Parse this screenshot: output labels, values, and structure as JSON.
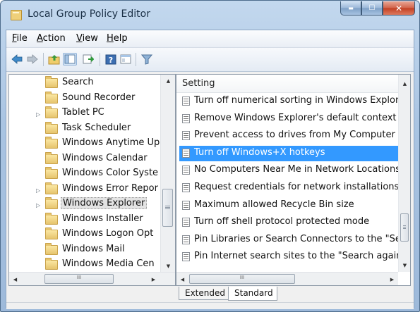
{
  "window": {
    "title": "Local Group Policy Editor",
    "controls": {
      "minimize": "▬",
      "maximize": "☐",
      "close": "✕"
    }
  },
  "menu": {
    "file": {
      "accel": "F",
      "rest": "ile"
    },
    "action": {
      "accel": "A",
      "rest": "ction"
    },
    "view": {
      "accel": "V",
      "rest": "iew"
    },
    "help": {
      "accel": "H",
      "rest": "elp"
    }
  },
  "toolbar": {
    "buttons": [
      "back-arrow-icon",
      "forward-arrow-icon",
      "up-folder-icon",
      "show-hide-tree-icon",
      "export-list-icon",
      "help-icon",
      "properties-icon",
      "filter-icon"
    ],
    "selected": "show-hide-tree-icon"
  },
  "tree": {
    "items": [
      {
        "label": "Search",
        "expandable": false
      },
      {
        "label": "Sound Recorder",
        "expandable": false
      },
      {
        "label": "Tablet PC",
        "expandable": true
      },
      {
        "label": "Task Scheduler",
        "expandable": false
      },
      {
        "label": "Windows Anytime Up",
        "expandable": false
      },
      {
        "label": "Windows Calendar",
        "expandable": false
      },
      {
        "label": "Windows Color Syste",
        "expandable": false
      },
      {
        "label": "Windows Error Repor",
        "expandable": true
      },
      {
        "label": "Windows Explorer",
        "expandable": true,
        "selected": true
      },
      {
        "label": "Windows Installer",
        "expandable": false
      },
      {
        "label": "Windows Logon Opt",
        "expandable": false
      },
      {
        "label": "Windows Mail",
        "expandable": false
      },
      {
        "label": "Windows Media Cen",
        "expandable": false
      }
    ],
    "hscroll_label": "III"
  },
  "list": {
    "column_header": "Setting",
    "rows": [
      {
        "label": "Turn off numerical sorting in Windows Explore"
      },
      {
        "label": "Remove Windows Explorer's default context m"
      },
      {
        "label": "Prevent access to drives from My Computer"
      },
      {
        "label": "Turn off Windows+X hotkeys",
        "selected": true
      },
      {
        "label": "No Computers Near Me in Network Locations"
      },
      {
        "label": "Request credentials for network installations"
      },
      {
        "label": "Maximum allowed Recycle Bin size"
      },
      {
        "label": "Turn off shell protocol protected mode"
      },
      {
        "label": "Pin Libraries or Search Connectors to the \"Sear"
      },
      {
        "label": "Pin Internet search sites to the \"Search again\" li"
      }
    ],
    "hscroll_label": "III"
  },
  "tabs": {
    "items": [
      {
        "label": "Extended",
        "active": false
      },
      {
        "label": "Standard",
        "active": true
      }
    ]
  },
  "colors": {
    "selection": "#3399ff",
    "title_bar": "#a9c4e2",
    "close_button": "#c23f22",
    "folder": "#e6c46d"
  }
}
